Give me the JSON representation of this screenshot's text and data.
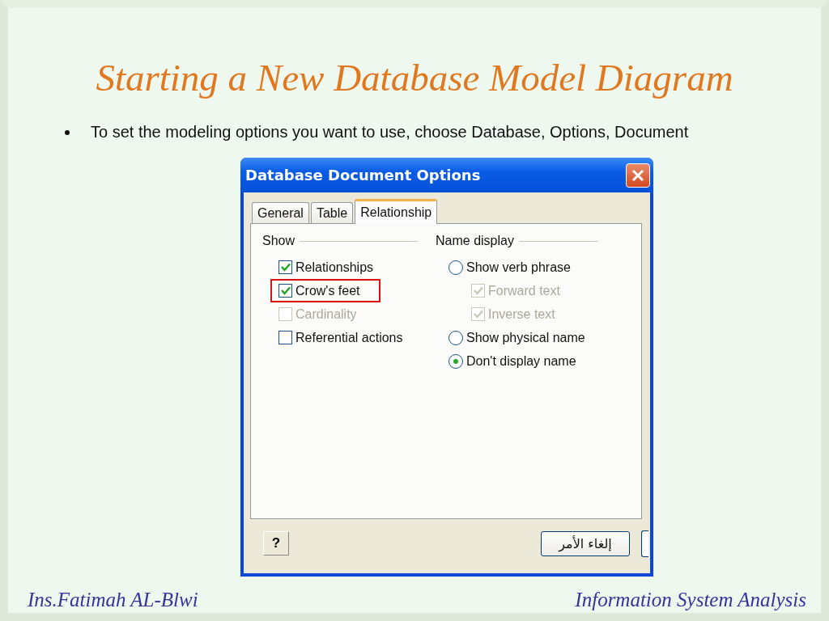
{
  "slide": {
    "title": "Starting a New Database Model Diagram",
    "bullets": [
      "To set the modeling options you want to use, choose Database, Options, Document"
    ]
  },
  "dialog": {
    "title": "Database Document Options",
    "tabs": [
      {
        "label": "General",
        "selected": false
      },
      {
        "label": "Table",
        "selected": false
      },
      {
        "label": "Relationship",
        "selected": true
      }
    ],
    "show": {
      "label": "Show",
      "items": [
        {
          "label": "Relationships",
          "checked": true,
          "disabled": false,
          "highlighted": false
        },
        {
          "label": "Crow's feet",
          "checked": true,
          "disabled": false,
          "highlighted": true
        },
        {
          "label": "Cardinality",
          "checked": false,
          "disabled": true,
          "highlighted": false
        },
        {
          "label": "Referential actions",
          "checked": false,
          "disabled": false,
          "highlighted": false
        }
      ]
    },
    "name_display": {
      "label": "Name display",
      "items": [
        {
          "kind": "radio",
          "label": "Show verb phrase",
          "selected": false,
          "children": [
            {
              "kind": "checkbox",
              "label": "Forward text",
              "checked": true,
              "disabled": true
            },
            {
              "kind": "checkbox",
              "label": "Inverse text",
              "checked": true,
              "disabled": true
            }
          ]
        },
        {
          "kind": "radio",
          "label": "Show physical name",
          "selected": false
        },
        {
          "kind": "radio",
          "label": "Don't display name",
          "selected": true
        }
      ]
    },
    "help_button": "?",
    "buttons": [
      "إلغاء الأمر"
    ]
  },
  "footer": {
    "left": "Ins.Fatimah AL-Blwi",
    "right": "Information System Analysis"
  }
}
